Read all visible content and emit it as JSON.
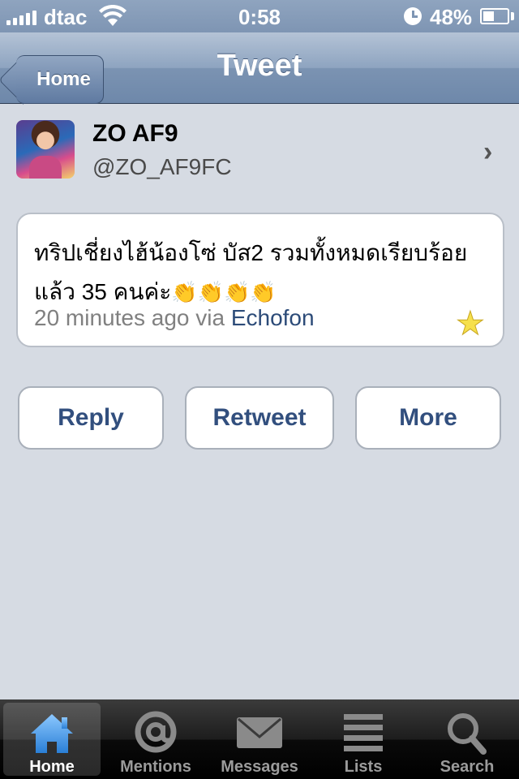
{
  "status_bar": {
    "carrier": "dtac",
    "time": "0:58",
    "battery_percent": "48%",
    "battery_level": 0.48
  },
  "nav": {
    "back_label": "Home",
    "title": "Tweet"
  },
  "profile": {
    "display_name": "ZO AF9",
    "handle": "@ZO_AF9FC"
  },
  "tweet": {
    "text": "ทริปเชี่ยงไฮ้น้องโซ่ บัส2 รวมทั้งหมดเรียบร้อยแล้ว 35 คนค่ะ",
    "emoji": "👏👏👏👏",
    "time_ago": "20 minutes ago via",
    "source": "Echofon"
  },
  "actions": {
    "reply": "Reply",
    "retweet": "Retweet",
    "more": "More"
  },
  "tabs": [
    {
      "label": "Home",
      "icon": "home-icon",
      "active": true
    },
    {
      "label": "Mentions",
      "icon": "at-icon",
      "active": false
    },
    {
      "label": "Messages",
      "icon": "envelope-icon",
      "active": false
    },
    {
      "label": "Lists",
      "icon": "list-icon",
      "active": false
    },
    {
      "label": "Search",
      "icon": "search-icon",
      "active": false
    }
  ],
  "colors": {
    "link": "#2c4b78",
    "button_text": "#324f7e",
    "active_tab_icon": "#3f9ae8"
  }
}
